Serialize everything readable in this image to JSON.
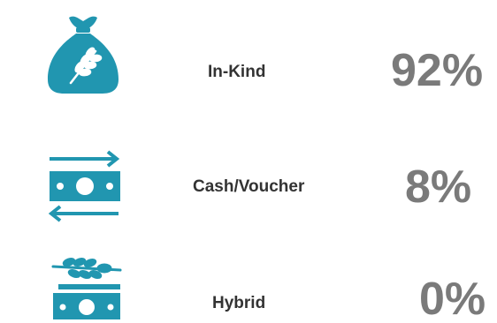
{
  "colors": {
    "icon": "#2196b0",
    "label": "#333333",
    "percent": "#7a7a7a"
  },
  "rows": [
    {
      "icon": "grain-sack-icon",
      "label": "In-Kind",
      "percent": "92%"
    },
    {
      "icon": "cash-transfer-icon",
      "label": "Cash/Voucher",
      "percent": "8%"
    },
    {
      "icon": "hybrid-grain-cash-icon",
      "label": "Hybrid",
      "percent": "0%"
    }
  ]
}
